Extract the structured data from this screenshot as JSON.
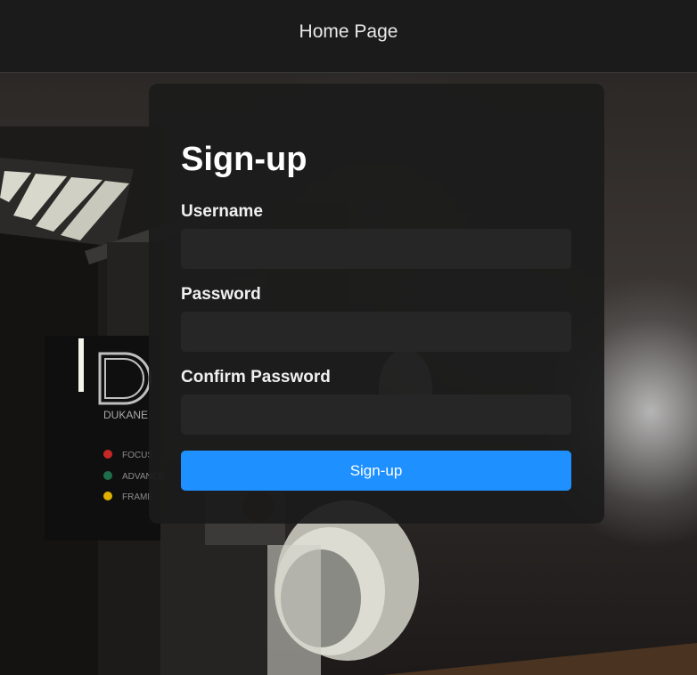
{
  "nav": {
    "home_link": "Home Page"
  },
  "form": {
    "title": "Sign-up",
    "fields": [
      {
        "label": "Username",
        "value": ""
      },
      {
        "label": "Password",
        "value": ""
      },
      {
        "label": "Confirm Password",
        "value": ""
      }
    ],
    "submit_label": "Sign-up"
  },
  "background": {
    "brand": "DUKANE",
    "controls": [
      "FOCUS",
      "ADVANCE",
      "FRAME"
    ],
    "accent_color": "#1e90ff"
  }
}
